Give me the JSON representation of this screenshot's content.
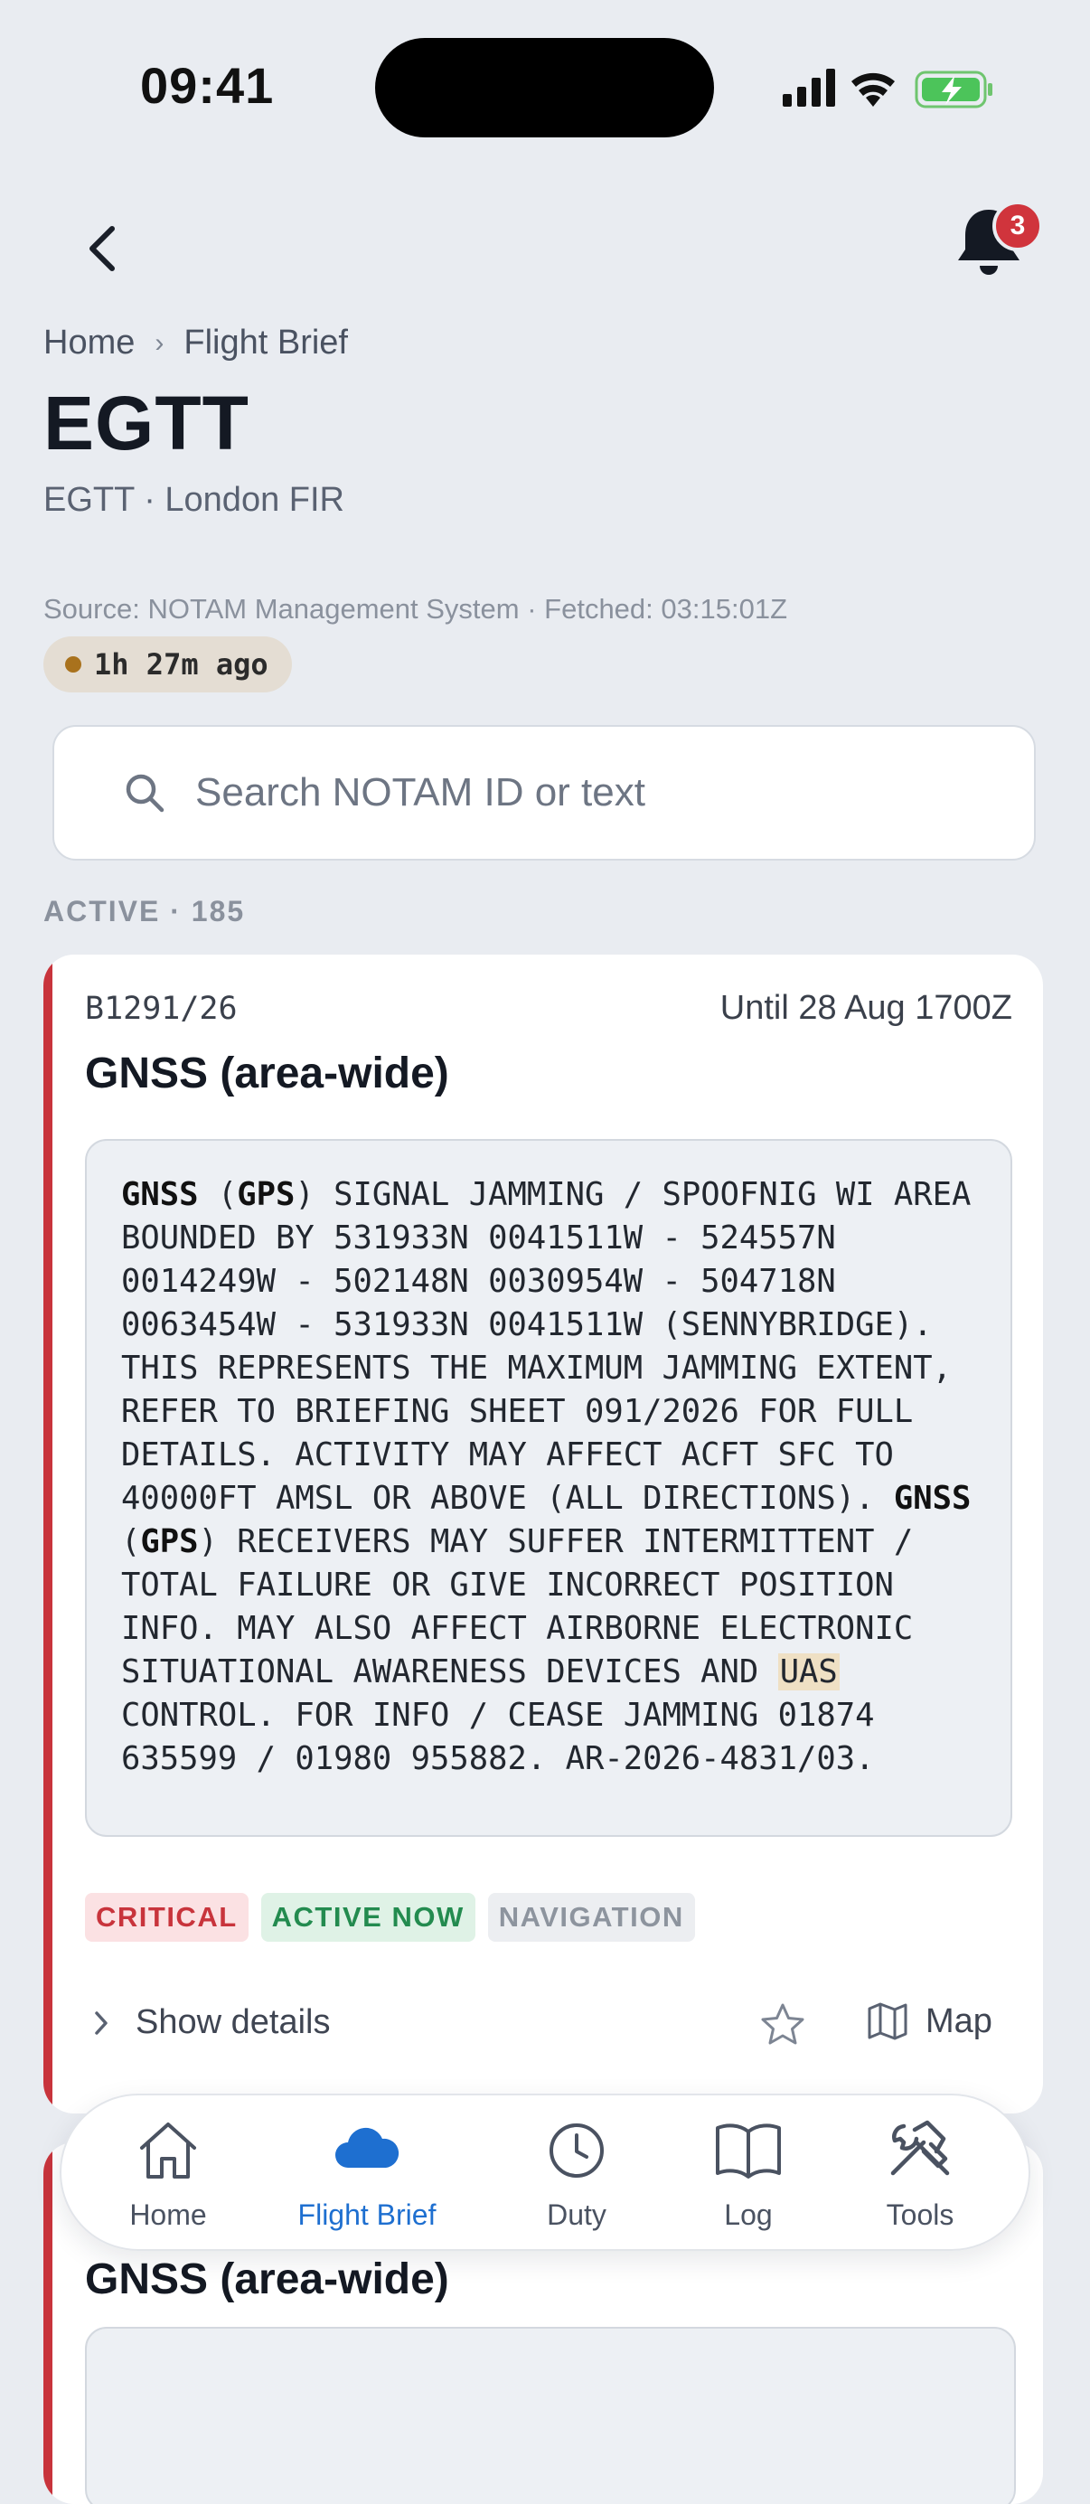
{
  "status_bar": {
    "time": "09:41"
  },
  "header": {
    "notification_count": "3"
  },
  "breadcrumb": {
    "home": "Home",
    "separator": "›",
    "current": "Flight Brief"
  },
  "page": {
    "title": "EGTT",
    "subtitle": "EGTT · London FIR",
    "source": "Source: NOTAM Management System · Fetched: 03:15:01Z",
    "age": "1h 27m ago"
  },
  "search": {
    "placeholder": "Search NOTAM ID or text",
    "value": ""
  },
  "section": {
    "label": "ACTIVE · 185"
  },
  "notams": [
    {
      "id": "B1291/26",
      "validity": "Until 28 Aug 1700Z",
      "title": "GNSS (area-wide)",
      "text_parts": [
        {
          "t": "GNSS",
          "s": "b"
        },
        {
          "t": " (",
          "s": ""
        },
        {
          "t": "GPS",
          "s": "b"
        },
        {
          "t": ") SIGNAL JAMMING / SPOOFNIG WI AREA BOUNDED BY 531933N 0041511W - 524557N 0014249W - 502148N 0030954W - 504718N 0063454W - 531933N 0041511W (SENNYBRIDGE). THIS REPRESENTS THE MAXIMUM JAMMING EXTENT, REFER TO BRIEFING SHEET 091/2026 FOR FULL DETAILS. ACTIVITY MAY AFFECT ACFT SFC TO 40000FT AMSL OR ABOVE (ALL DIRECTIONS). ",
          "s": ""
        },
        {
          "t": "GNSS",
          "s": "b"
        },
        {
          "t": " (",
          "s": ""
        },
        {
          "t": "GPS",
          "s": "b"
        },
        {
          "t": ") RECEIVERS MAY SUFFER INTERMITTENT / TOTAL FAILURE OR GIVE INCORRECT POSITION INFO. MAY ALSO AFFECT AIRBORNE ELECTRONIC SITUATIONAL AWARENESS DEVICES AND ",
          "s": ""
        },
        {
          "t": "UAS",
          "s": "h"
        },
        {
          "t": " CONTROL. FOR INFO / CEASE JAMMING 01874 635599 / 01980 955882. AR-2026-4831/03.",
          "s": ""
        }
      ],
      "tags": {
        "critical": "CRITICAL",
        "active": "ACTIVE NOW",
        "category": "NAVIGATION"
      },
      "show_details": "Show details",
      "map": "Map"
    },
    {
      "title": "GNSS (area-wide)"
    }
  ],
  "tabbar": {
    "home": "Home",
    "flight_brief": "Flight Brief",
    "duty": "Duty",
    "log": "Log",
    "tools": "Tools"
  },
  "colors": {
    "accent": "#1e6fd0",
    "critical": "#c8343c",
    "active": "#238b4f",
    "badge": "#d0343c"
  }
}
